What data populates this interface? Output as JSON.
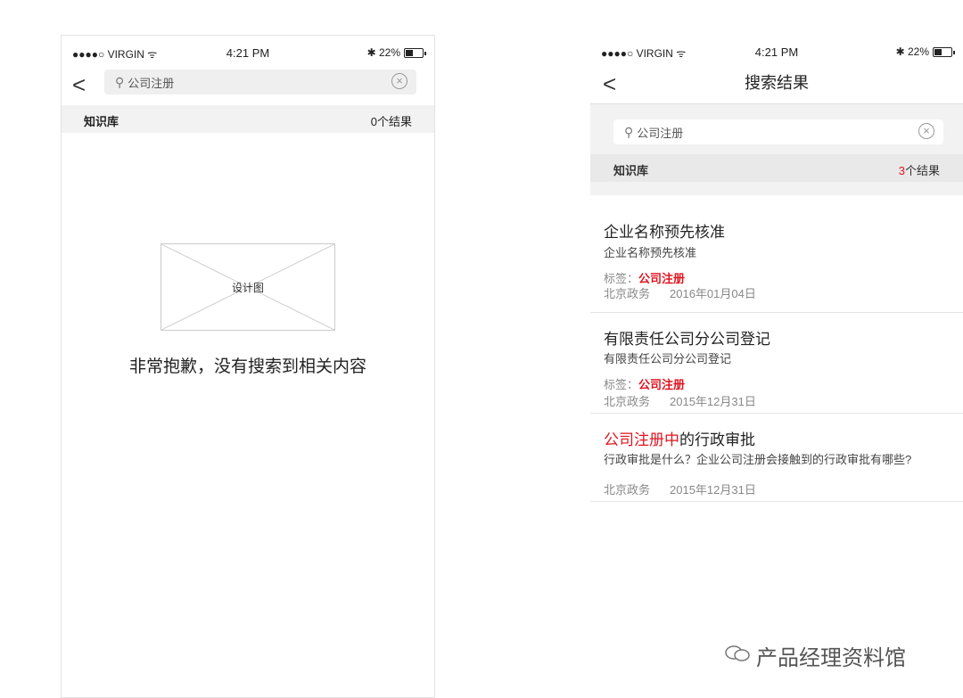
{
  "left": {
    "status": {
      "carrier": "●●●●○ VIRGIN ᯤ",
      "time": "4:21 PM",
      "battery": "✱ 22%"
    },
    "back_icon": "<",
    "search": {
      "value": "公司注册"
    },
    "section": {
      "label": "知识库",
      "count": "0个结果"
    },
    "placeholder_image_text": "设计图",
    "empty_message": "非常抱歉，没有搜索到相关内容"
  },
  "right": {
    "status": {
      "carrier": "●●●●○ VIRGIN ᯤ",
      "time": "4:21 PM",
      "battery": "✱ 22%"
    },
    "back_icon": "<",
    "title": "搜索结果",
    "search": {
      "value": "公司注册"
    },
    "section": {
      "label": "知识库",
      "count_num": "3",
      "count_suffix": "个结果"
    },
    "results": [
      {
        "title": "企业名称预先核准",
        "desc": "企业名称预先核准",
        "tag_label": "标签：",
        "tag_value": "公司注册",
        "source": "北京政务",
        "date": "2016年01月04日"
      },
      {
        "title": "有限责任公司分公司登记",
        "desc": "有限责任公司分公司登记",
        "tag_label": "标签：",
        "tag_value": "公司注册",
        "source": "北京政务",
        "date": "2015年12月31日"
      },
      {
        "title_highlight": "公司注册中",
        "title_rest": "的行政审批",
        "desc": "行政审批是什么？企业公司注册会接触到的行政审批有哪些?",
        "source": "北京政务",
        "date": "2015年12月31日"
      }
    ]
  },
  "watermark": "产品经理资料馆",
  "colors": {
    "accent_red": "#e0141e",
    "section_bg": "#f2f2f2",
    "search_bg": "#efefef"
  }
}
